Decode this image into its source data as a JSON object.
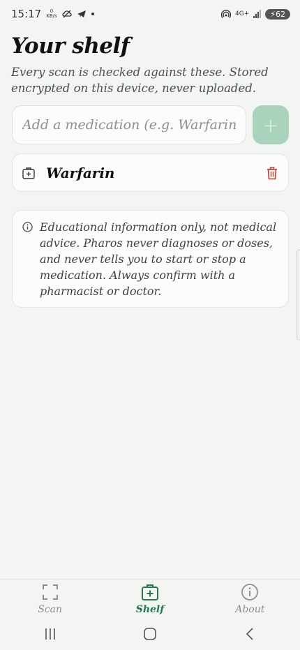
{
  "status_bar": {
    "time": "15:17",
    "net_speed_value": "0",
    "net_speed_unit": "KB/s",
    "network": "4G+",
    "battery": "62"
  },
  "page": {
    "title": "Your shelf",
    "subtitle": "Every scan is checked against these. Stored encrypted on this device, never uploaded."
  },
  "add_medication": {
    "placeholder": "Add a medication (e.g. Warfarin)",
    "button_label": "+"
  },
  "medications": [
    {
      "name": "Warfarin"
    }
  ],
  "disclaimer": {
    "text": "Educational information only, not medical advice. Pharos never diagnoses or doses, and never tells you to start or stop a medication. Always confirm with a pharmacist or doctor."
  },
  "bottom_nav": {
    "items": [
      {
        "label": "Scan",
        "icon": "scan-frame-icon",
        "active": false
      },
      {
        "label": "Shelf",
        "icon": "medkit-icon",
        "active": true
      },
      {
        "label": "About",
        "icon": "info-circle-icon",
        "active": false
      }
    ]
  },
  "colors": {
    "accent": "#1f7a4d",
    "add_button_disabled": "#a9d3bc",
    "delete": "#c0392b",
    "background": "#f3f5f3"
  }
}
